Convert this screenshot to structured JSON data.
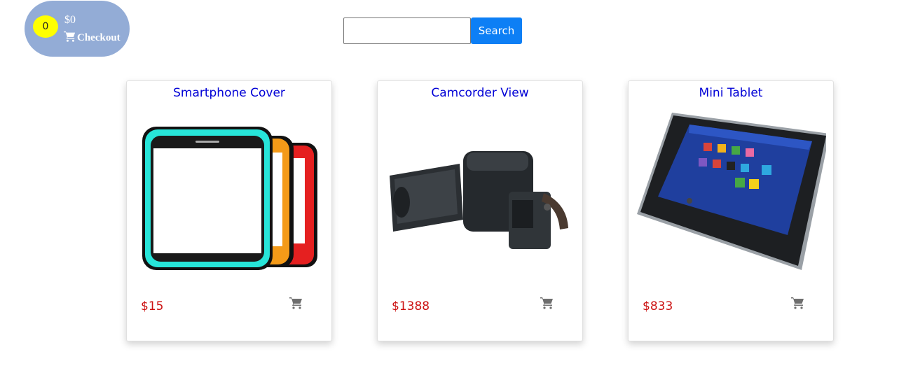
{
  "cart": {
    "count": "0",
    "total": "$0",
    "checkout_label": "Checkout",
    "pill_color": "#93acd6",
    "badge_color": "#ffff00"
  },
  "search": {
    "value": "",
    "placeholder": "",
    "button_label": "Search",
    "button_color": "#0d7ff5"
  },
  "products": [
    {
      "title": "Smartphone Cover",
      "price": "$15",
      "image": "phone-cases-image"
    },
    {
      "title": "Camcorder View",
      "price": "$1388",
      "image": "camcorder-image"
    },
    {
      "title": "Mini Tablet",
      "price": "$833",
      "image": "tablet-image"
    }
  ],
  "colors": {
    "title": "#0000d6",
    "price": "#cc1111",
    "cart_icon": "#6e6e6e"
  }
}
